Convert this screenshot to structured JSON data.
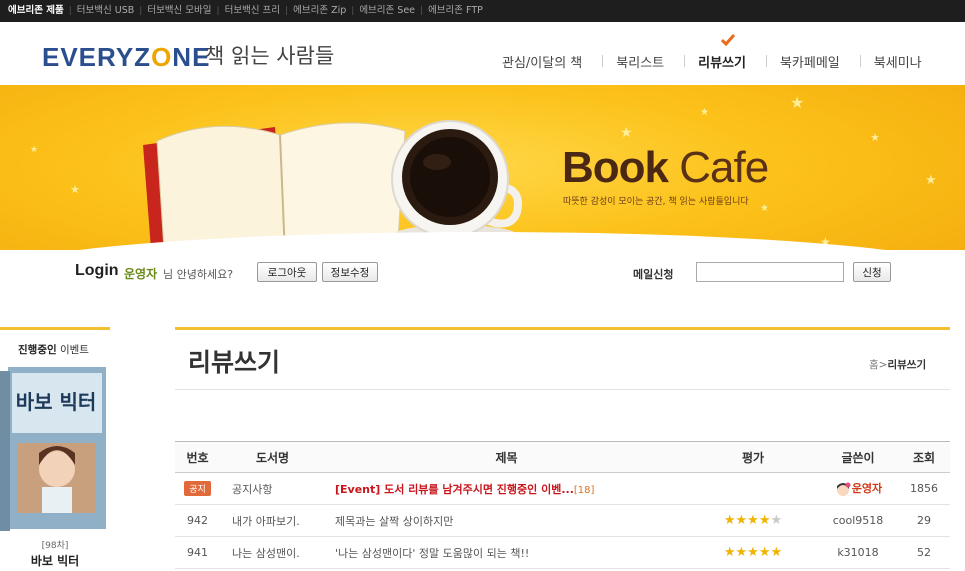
{
  "topbar": {
    "items": [
      "에브리존 제품",
      "터보백신 USB",
      "터보백신 모바일",
      "터보백신 프리",
      "에브리존 Zip",
      "에브리존 See",
      "에브리존 FTP"
    ]
  },
  "header": {
    "logo_text_1": "EVERYZ",
    "logo_text_o": "O",
    "logo_text_2": "NE",
    "tagline": "책 읽는 사람들",
    "nav": [
      {
        "label": "관심/이달의 책"
      },
      {
        "label": "북리스트"
      },
      {
        "label": "리뷰쓰기",
        "active": true
      },
      {
        "label": "북카페메일"
      },
      {
        "label": "북세미나"
      }
    ]
  },
  "banner": {
    "title_bold": "Book",
    "title_light": "Cafe",
    "subtitle": "따뜻한 감성이 모이는 공간, 책 읽는 사람들입니다"
  },
  "login": {
    "title": "Login",
    "user_name": "운영자",
    "greeting": "님 안녕하세요?",
    "logout_label": "로그아웃",
    "edit_label": "정보수정",
    "mail_label": "메일신청",
    "mail_value": "",
    "apply_label": "신청"
  },
  "event": {
    "title_bold": "진행중인",
    "title_rest": " 이벤트",
    "cover_text": "바보 빅터",
    "number": "[98차]",
    "name": "바보 빅터"
  },
  "page": {
    "title": "리뷰쓰기",
    "breadcrumb_home": "홈",
    "breadcrumb_sep": ">",
    "breadcrumb_current": "리뷰쓰기"
  },
  "board": {
    "headers": [
      "번호",
      "도서명",
      "제목",
      "평가",
      "글쓴이",
      "조회"
    ],
    "notice_badge": "공지",
    "rows": [
      {
        "no": "",
        "notice": true,
        "book": "공지사항",
        "subject": "[Event] 도서 리뷰를 남겨주시면 진행중인 이벤...",
        "comments": "[18]",
        "rating": 0,
        "author": "운영자",
        "views": "1856"
      },
      {
        "no": "942",
        "notice": false,
        "book": "내가 아파보기.",
        "subject": "제목과는 살짝 상이하지만",
        "comments": "",
        "rating": 4,
        "author": "cool9518",
        "views": "29"
      },
      {
        "no": "941",
        "notice": false,
        "book": "나는 삼성맨이.",
        "subject": "'나는 삼성맨이다' 정말 도움많이 되는 책!!",
        "comments": "",
        "rating": 5,
        "author": "k31018",
        "views": "52"
      }
    ]
  },
  "colors": {
    "accent_yellow": "#f0c030",
    "logo_blue": "#2b4e8e",
    "hot_red": "#c8161d",
    "star": "#f0b400"
  }
}
